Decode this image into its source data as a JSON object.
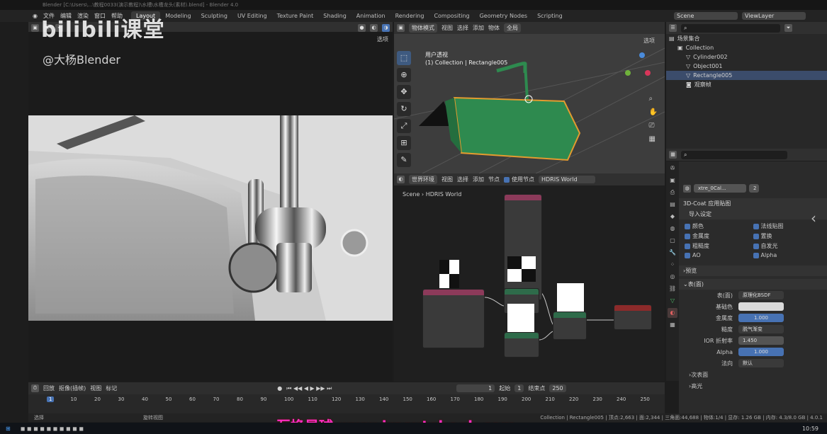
{
  "titlebar": {
    "text": "Blender [C:\\Users\\...\\教程0033(演示教程)\\水槽\\水槽龙头(素材).blend] - Blender 4.0"
  },
  "watermark": {
    "logo": "bilibili课堂",
    "author": "@大杨Blender"
  },
  "menu": {
    "items": [
      "文件",
      "编辑",
      "渲染",
      "窗口",
      "帮助"
    ]
  },
  "workspaces": [
    "Layout",
    "Modeling",
    "Sculpting",
    "UV Editing",
    "Texture Paint",
    "Shading",
    "Animation",
    "Rendering",
    "Compositing",
    "Geometry Nodes",
    "Scripting"
  ],
  "scene": {
    "name": "Scene",
    "view_layer": "ViewLayer"
  },
  "left_view": {
    "options_label": "选项"
  },
  "viewport": {
    "mode": "物体模式",
    "menu": [
      "视图",
      "选择",
      "添加",
      "物体"
    ],
    "transform": "全局",
    "options_label": "选项",
    "view_name": "用户透视",
    "collection_info": "(1) Collection | Rectangle005"
  },
  "node_editor": {
    "type": "世界环境",
    "menu": [
      "视图",
      "选择",
      "添加",
      "节点"
    ],
    "use_nodes_label": "使用节点",
    "world": "HDRIS World",
    "breadcrumb_scene": "Scene",
    "breadcrumb_world": "HDRIS World"
  },
  "outliner": {
    "root": "场景集合",
    "rows": [
      {
        "name": "Collection",
        "indent": 1,
        "icon": "collection-icon"
      },
      {
        "name": "Cylinder002",
        "indent": 2,
        "icon": "mesh-icon"
      },
      {
        "name": "Object001",
        "indent": 2,
        "icon": "mesh-icon"
      },
      {
        "name": "Rectangle005",
        "indent": 2,
        "icon": "mesh-icon",
        "selected": true
      },
      {
        "name": "观察帧",
        "indent": 2,
        "icon": "camera-icon"
      }
    ]
  },
  "properties": {
    "material_name": "xtre_0Cal...",
    "material_users": "2",
    "addon_header": "3D-Coat 应用贴图",
    "import_section": "导入设定",
    "checks_left": [
      "颜色",
      "金属度",
      "粗糙度",
      "AO"
    ],
    "checks_right": [
      "法线贴图",
      "置换",
      "自发光",
      "Alpha"
    ],
    "preview_section": "预览",
    "surface_section": "表(面)",
    "surface_value": "原理化BSDF",
    "fields": [
      {
        "label": "基础色",
        "value": "",
        "style": "light"
      },
      {
        "label": "金属度",
        "value": "1.000",
        "style": "blue"
      },
      {
        "label": "糙度",
        "value": "脱气渐变",
        "style": "dark"
      },
      {
        "label": "IOR 折射率",
        "value": "1.450",
        "style": "normal"
      },
      {
        "label": "Alpha",
        "value": "1.000",
        "style": "blue"
      },
      {
        "label": "法向",
        "value": "默认",
        "style": "dark"
      }
    ],
    "subsurface": "次表面",
    "specular": "高光"
  },
  "timeline": {
    "playback": "回放",
    "keying": "抠像(插帧)",
    "view": "视图",
    "marker": "标记",
    "current_frame": "1",
    "start_label": "起始",
    "start": "1",
    "end_label": "结束点",
    "end": "250",
    "ticks": [
      "1",
      "10",
      "20",
      "30",
      "40",
      "50",
      "60",
      "70",
      "80",
      "90",
      "100",
      "110",
      "120",
      "130",
      "140",
      "150",
      "160",
      "170",
      "180",
      "190",
      "200",
      "210",
      "220",
      "230",
      "240",
      "250"
    ]
  },
  "statusbar": {
    "left": "选择",
    "mid": "旋转视图",
    "right": "Collection | Rectangle005 | 顶点:2,663 | 面:2,344 | 三角面:44,688 | 物体:1/4 | 显存: 1.26 GB | 内存: 4.3/8.0 GB | 4.0.1"
  },
  "bottom_watermark": "互换星球 www.irasutobook.com",
  "taskbar": {
    "time": "10:59"
  },
  "colors": {
    "accent": "#4772b3",
    "selected_object": "#2e8a4f",
    "watermark_pink": "#ff2ec4"
  }
}
